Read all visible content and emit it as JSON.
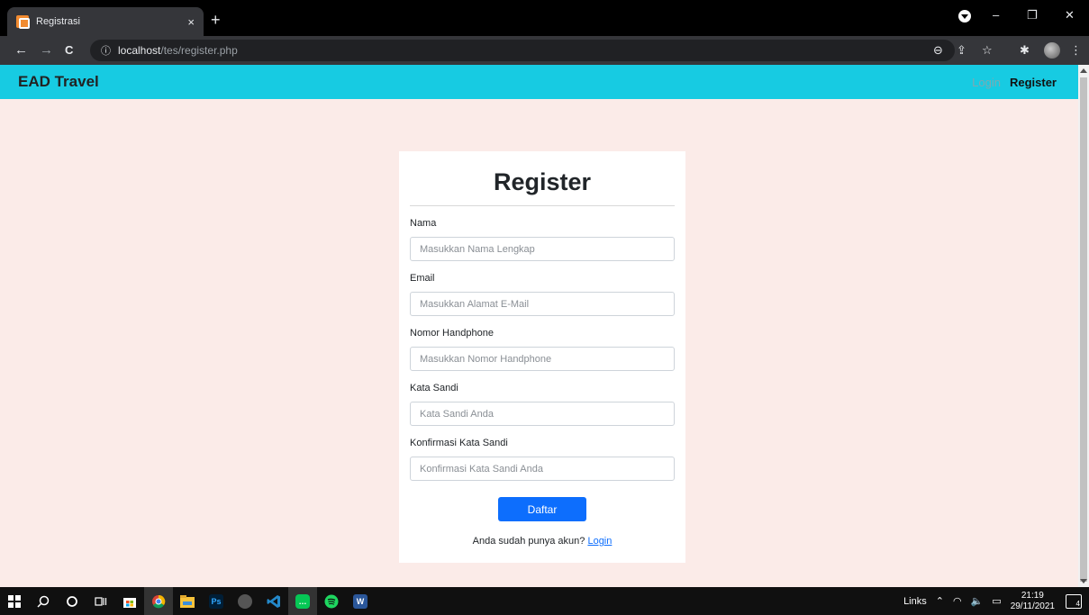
{
  "browser": {
    "tab_title": "Registrasi",
    "tab_close": "×",
    "new_tab": "+",
    "url_host": "localhost",
    "url_path": "/tes/register.php",
    "info_icon": "ⓘ",
    "win_minimize": "–",
    "win_restore": "❐",
    "win_close": "✕",
    "back": "←",
    "forward": "→",
    "reload": "C",
    "zoom_icon": "⊖",
    "share_icon": "⇪",
    "star_icon": "☆",
    "extensions_icon": "✱",
    "menu_icon": "⋮"
  },
  "site": {
    "brand": "EAD Travel",
    "nav_login": "Login",
    "nav_register": "Register"
  },
  "form": {
    "title": "Register",
    "fields": [
      {
        "label": "Nama",
        "placeholder": "Masukkan Nama Lengkap"
      },
      {
        "label": "Email",
        "placeholder": "Masukkan Alamat E-Mail"
      },
      {
        "label": "Nomor Handphone",
        "placeholder": "Masukkan Nomor Handphone"
      },
      {
        "label": "Kata Sandi",
        "placeholder": "Kata Sandi Anda"
      },
      {
        "label": "Konfirmasi Kata Sandi",
        "placeholder": "Konfirmasi Kata Sandi Anda"
      }
    ],
    "submit_label": "Daftar",
    "footer_text": "Anda sudah punya akun? ",
    "footer_link": "Login"
  },
  "taskbar": {
    "links_label": "Links",
    "time": "21:19",
    "date": "29/11/2021",
    "notifications": "4",
    "ps_label": "Ps",
    "word_label": "W"
  },
  "colors": {
    "navbar": "#17cbe2",
    "page_bg": "#fbebe8",
    "primary_button": "#0d6efd"
  }
}
